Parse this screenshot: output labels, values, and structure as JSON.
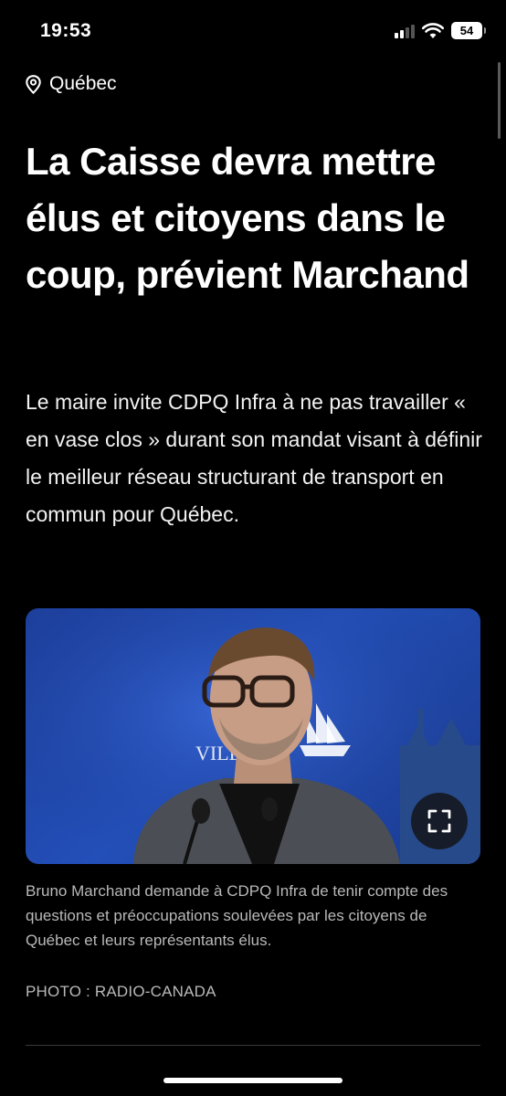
{
  "status_bar": {
    "time": "19:53",
    "battery": "54"
  },
  "article": {
    "location": "Québec",
    "headline": "La Caisse devra mettre élus et citoyens dans le coup, prévient Marchand",
    "lede": "Le maire invite CDPQ Infra à ne pas travailler « en vase clos » durant son mandat visant à définir le meilleur réseau structurant de transport en commun pour Québec.",
    "photo": {
      "backdrop_text": "VILL",
      "caption": "Bruno Marchand demande à CDPQ Infra de tenir compte des questions et préoccupations soulevées par les citoyens de Québec et leurs représentants élus.",
      "credit": "PHOTO : RADIO-CANADA"
    }
  },
  "icons": {
    "location": "location-pin-icon",
    "expand": "fullscreen-expand-icon",
    "wifi": "wifi-icon",
    "signal": "cellular-signal-icon",
    "battery": "battery-icon"
  },
  "colors": {
    "background": "#000000",
    "text": "#ffffff",
    "caption": "#b9b9b9",
    "photo_backdrop": "#234fb8"
  }
}
